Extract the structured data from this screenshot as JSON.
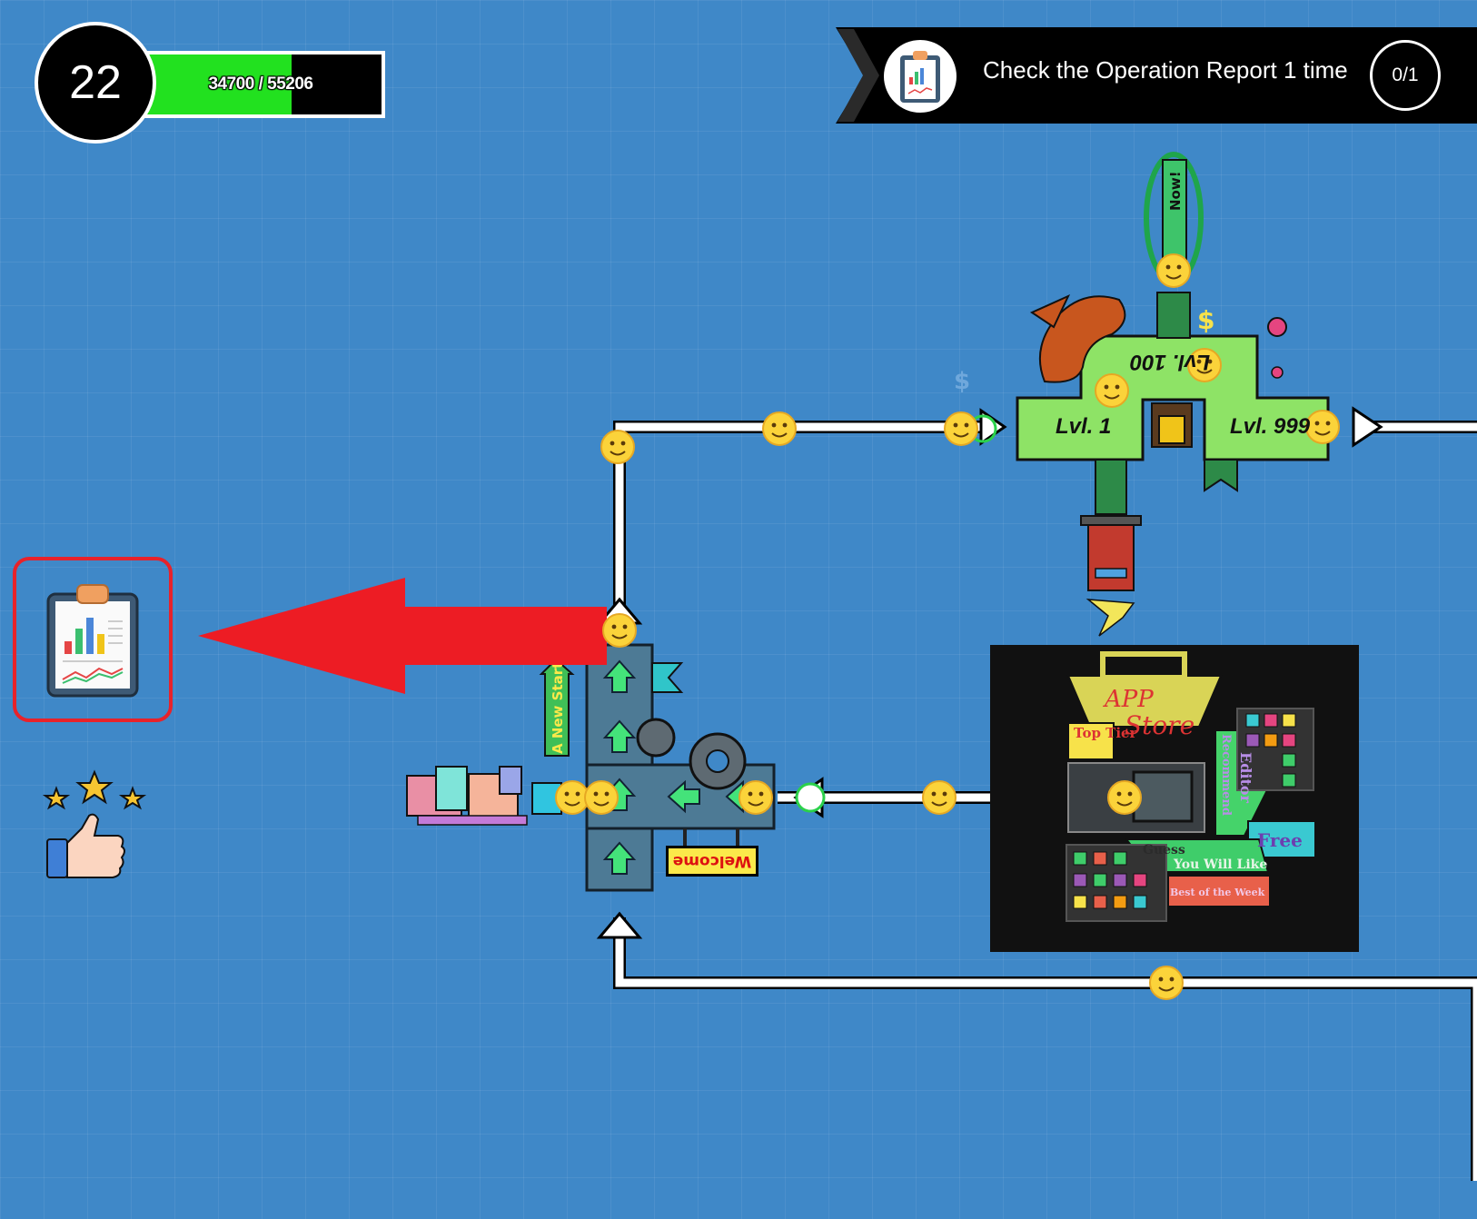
{
  "hud": {
    "level": "22",
    "xp_text": "34700 / 55206",
    "xp_current": 34700,
    "xp_max": 55206,
    "xp_fill_color": "#22e11f"
  },
  "quest": {
    "text": "Check the Operation Report 1 time",
    "progress": "0/1",
    "icon": "clipboard-report-icon"
  },
  "sidebar": {
    "report_icon": "clipboard-report-icon",
    "rating_icon": "thumbs-up-stars-icon",
    "highlight_color": "#e8222a"
  },
  "map": {
    "signs": {
      "welcome": "Welcome",
      "new_start": "A New Start",
      "now": "Now!"
    },
    "dungeon": {
      "level_1": "Lvl. 1",
      "level_100": "Lvl. 100",
      "level_999": "Lvl. 999"
    },
    "app_store": {
      "title_1": "APP",
      "title_2": "Store",
      "top_tier": "Top Tier",
      "editor_recommend_1": "Editor",
      "editor_recommend_2": "Recommend",
      "free": "Free",
      "guess": "Guess",
      "you_will_like": "You Will Like",
      "best_of_week": "Best of the Week"
    },
    "pointer_color": "#ed1c24",
    "path_color": "#ffffff"
  }
}
